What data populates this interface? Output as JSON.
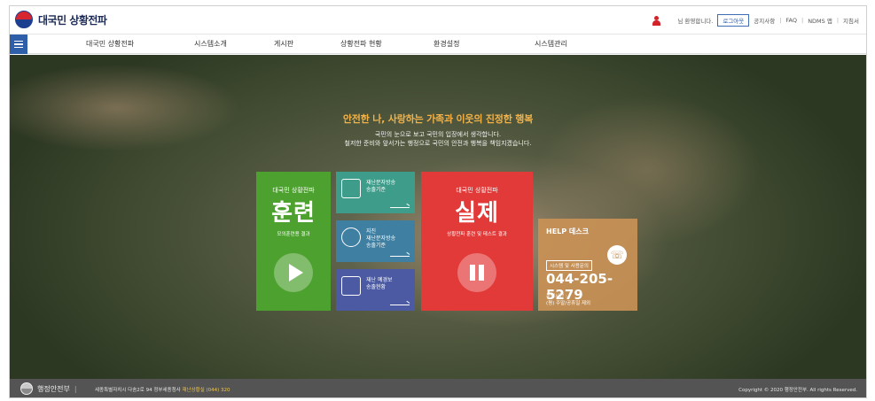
{
  "header": {
    "site_title": "대국민 상황전파",
    "greeting": "님 환영합니다.",
    "logout_label": "로그아웃",
    "links": [
      "공지사항",
      "FAQ",
      "NDMS 앱",
      "지침서"
    ]
  },
  "nav": {
    "items": [
      "대국민 상황전파",
      "시스템소개",
      "게시판",
      "상황전파 현황",
      "환경설정",
      "시스템관리"
    ]
  },
  "hero": {
    "title": "안전한 나, 사랑하는 가족과 이웃의 진정한 행복",
    "subtitle_line1": "국민의 눈으로 보고 국민의 입장에서 생각합니다.",
    "subtitle_line2": "철저한 준비와 앞서가는 행정으로 국민의 안전과 행복을 책임지겠습니다."
  },
  "tiles": {
    "train": {
      "tag": "대국민 상황전파",
      "big": "훈련",
      "desc": "모의훈련용 결과"
    },
    "real": {
      "tag": "대국민 상황전파",
      "big": "실제",
      "desc": "상황전파 훈련 및 테스트 결과"
    },
    "small": [
      {
        "line1": "재난문자방송",
        "line2": "송출기준"
      },
      {
        "line1": "지진",
        "line2": "재난문자방송",
        "line3": "송출기준"
      },
      {
        "line1": "재난 예경보",
        "line2": "송출현황"
      }
    ]
  },
  "help": {
    "title": "HELP 데스크",
    "tag": "시스템 및 사용문의",
    "number": "044-205-5279",
    "hours_label": "운영시간 :",
    "hours": "(평) 주말/공휴일 제외"
  },
  "footer": {
    "org": "행정안전부",
    "address_prefix": "세종특별자치시 다솜2로 94 정부세종청사",
    "address_highlight": "재난상황실 (044) 320",
    "copyright": "Copyright © 2020 행정안전부. All rights Reserved."
  },
  "colors": {
    "train_tile": "#4da12f",
    "real_tile": "#e23a39",
    "help_tile": "#c99156",
    "nav_menu": "#2f5fa8",
    "hero_title": "#f2b24a"
  }
}
